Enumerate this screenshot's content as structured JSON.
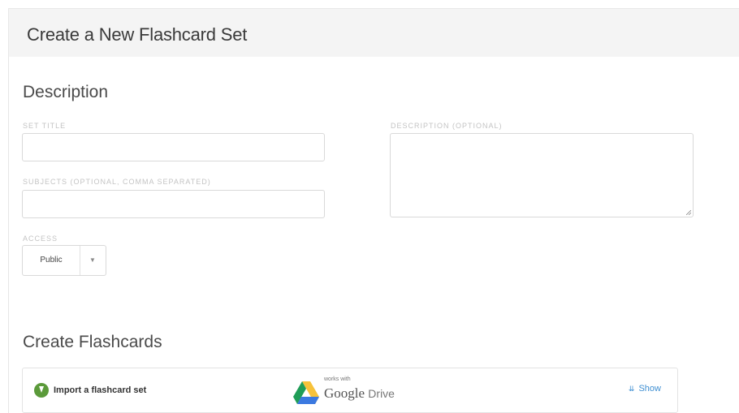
{
  "header": {
    "title": "Create a New Flashcard Set"
  },
  "description_section": {
    "title": "Description",
    "set_title_label": "SET TITLE",
    "set_title_value": "",
    "subjects_label": "SUBJECTS (OPTIONAL, COMMA SEPARATED)",
    "subjects_value": "",
    "description_label": "DESCRIPTION (OPTIONAL)",
    "description_value": "",
    "access_label": "ACCESS",
    "access_value": "Public"
  },
  "flashcards_section": {
    "title": "Create Flashcards",
    "import_label": "Import a flashcard set",
    "works_with": "works with",
    "google_label": "Google",
    "drive_label": "Drive",
    "show_label": "Show"
  },
  "colors": {
    "accent": "#3f8fd2",
    "import_icon": "#5b9a3a",
    "header_bg": "#f4f4f4"
  },
  "icons": {
    "import": "download-circle-icon",
    "show": "double-chevron-down-icon",
    "drive": "google-drive-icon"
  }
}
